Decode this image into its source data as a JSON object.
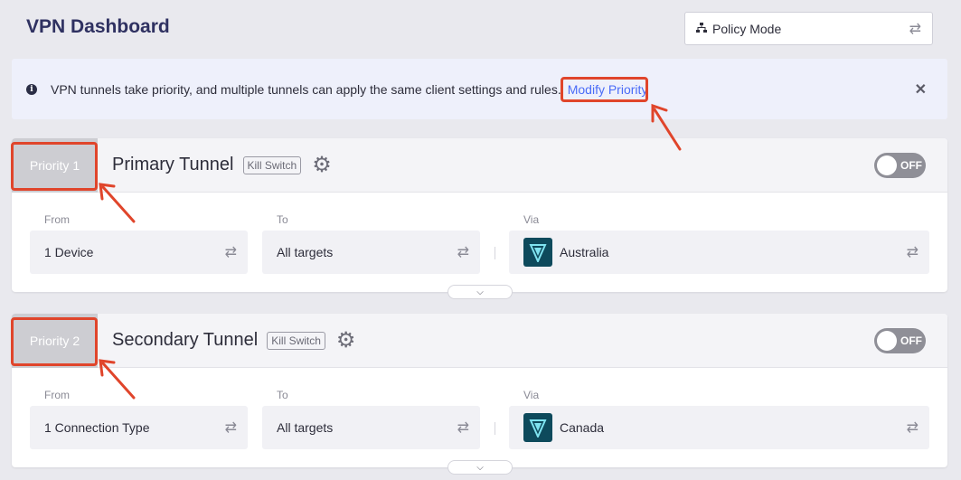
{
  "header": {
    "title": "VPN Dashboard"
  },
  "mode_select": {
    "icon": "sitemap-icon",
    "label": "Policy Mode",
    "swap_icon": "swap-icon"
  },
  "banner": {
    "icon": "info-icon",
    "text": "VPN tunnels take priority, and multiple tunnels can apply the same client settings and rules.",
    "link": "Modify Priority",
    "close": "✕"
  },
  "labels": {
    "from": "From",
    "to": "To",
    "via": "Via"
  },
  "tunnels": [
    {
      "priority": "Priority 1",
      "name": "Primary Tunnel",
      "kill_switch": "Kill Switch",
      "toggle": "OFF",
      "from": "1 Device",
      "to": "All targets",
      "via": "Australia"
    },
    {
      "priority": "Priority 2",
      "name": "Secondary Tunnel",
      "kill_switch": "Kill Switch",
      "toggle": "OFF",
      "from": "1 Connection Type",
      "to": "All targets",
      "via": "Canada"
    }
  ],
  "colors": {
    "highlight": "#e0452b",
    "link": "#4a6cf7",
    "title": "#2f3161"
  }
}
